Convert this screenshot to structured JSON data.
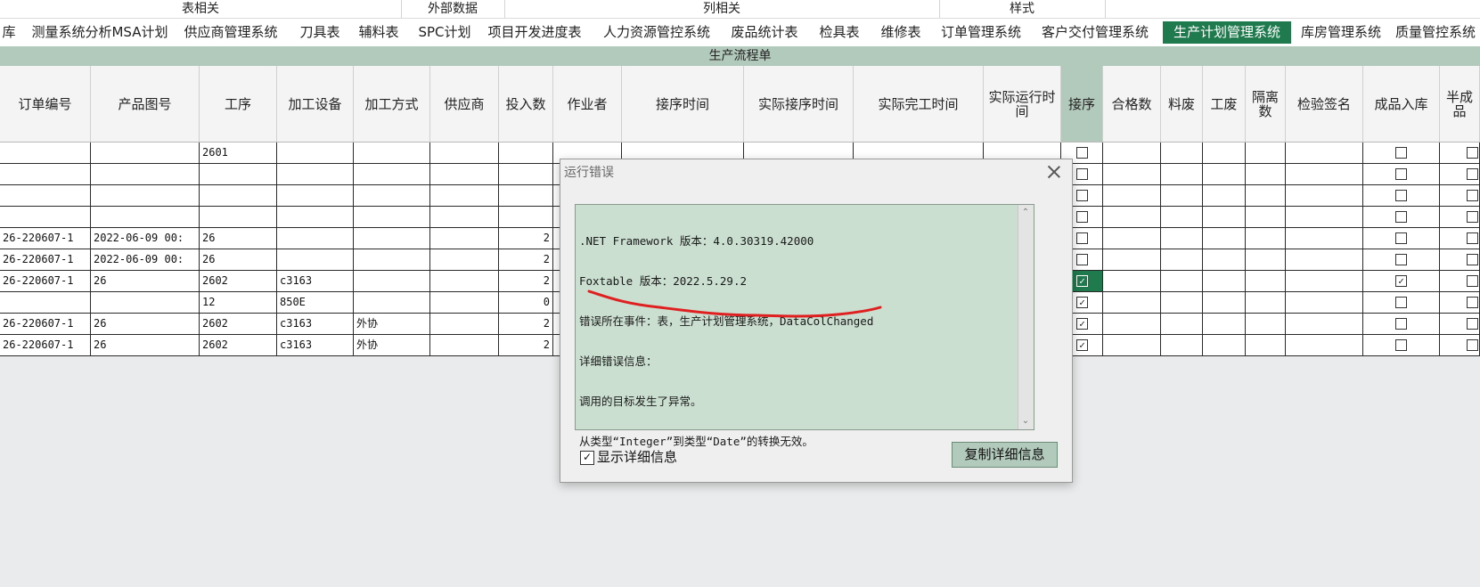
{
  "ribbon_groups": [
    "表相关",
    "外部数据",
    "列相关",
    "样式"
  ],
  "tabs": [
    {
      "label": "库",
      "active": false
    },
    {
      "label": "测量系统分析MSA计划",
      "active": false
    },
    {
      "label": "供应商管理系统",
      "active": false
    },
    {
      "label": "刀具表",
      "active": false
    },
    {
      "label": "辅料表",
      "active": false
    },
    {
      "label": "SPC计划",
      "active": false
    },
    {
      "label": "项目开发进度表",
      "active": false
    },
    {
      "label": "人力资源管控系统",
      "active": false
    },
    {
      "label": "废品统计表",
      "active": false
    },
    {
      "label": "检具表",
      "active": false
    },
    {
      "label": "维修表",
      "active": false
    },
    {
      "label": "订单管理系统",
      "active": false
    },
    {
      "label": "客户交付管理系统",
      "active": false
    },
    {
      "label": "生产计划管理系统",
      "active": true
    },
    {
      "label": "库房管理系统",
      "active": false
    },
    {
      "label": "质量管控系统",
      "active": false
    }
  ],
  "sheet_title": "生产流程单",
  "columns": [
    "订单编号",
    "产品图号",
    "工序",
    "加工设备",
    "加工方式",
    "供应商",
    "投入数",
    "作业者",
    "接序时间",
    "实际接序时间",
    "实际完工时间",
    "实际运行时间",
    "接序",
    "合格数",
    "料废",
    "工废",
    "隔离数",
    "检验签名",
    "成品入库",
    "半成品"
  ],
  "rows": [
    {
      "order": "",
      "drawing": "",
      "process": "2601",
      "equipment": "",
      "method": "",
      "supplier": "",
      "qty": "",
      "receive": false,
      "finished": false
    },
    {
      "order": "",
      "drawing": "",
      "process": "",
      "equipment": "",
      "method": "",
      "supplier": "",
      "qty": "",
      "receive": false,
      "finished": false
    },
    {
      "order": "",
      "drawing": "",
      "process": "",
      "equipment": "",
      "method": "",
      "supplier": "",
      "qty": "",
      "receive": false,
      "finished": false
    },
    {
      "order": "",
      "drawing": "",
      "process": "",
      "equipment": "",
      "method": "",
      "supplier": "",
      "qty": "",
      "receive": false,
      "finished": false
    },
    {
      "order": "26-220607-1",
      "drawing": "2022-06-09 00:",
      "process": "26",
      "equipment": "",
      "method": "",
      "supplier": "",
      "qty": "2",
      "receive": false,
      "finished": false
    },
    {
      "order": "26-220607-1",
      "drawing": "2022-06-09 00:",
      "process": "26",
      "equipment": "",
      "method": "",
      "supplier": "",
      "qty": "2",
      "receive": false,
      "finished": false
    },
    {
      "order": "26-220607-1",
      "drawing": "26",
      "process": "2602",
      "equipment": "c3163",
      "method": "",
      "supplier": "",
      "qty": "2",
      "receive": true,
      "finished": true
    },
    {
      "order": "",
      "drawing": "",
      "process": "12",
      "equipment": "850E",
      "method": "",
      "supplier": "",
      "qty": "0",
      "receive": true,
      "finished": false
    },
    {
      "order": "26-220607-1",
      "drawing": "26",
      "process": "2602",
      "equipment": "c3163",
      "method": "外协",
      "supplier": "",
      "qty": "2",
      "receive": true,
      "finished": false
    },
    {
      "order": "26-220607-1",
      "drawing": "26",
      "process": "2602",
      "equipment": "c3163",
      "method": "外协",
      "supplier": "",
      "qty": "2",
      "receive": true,
      "finished": false
    }
  ],
  "dialog": {
    "title": "运行错误",
    "lines": [
      ".NET Framework 版本：4.0.30319.42000",
      "Foxtable 版本：2022.5.29.2",
      "错误所在事件：表，生产计划管理系统，DataColChanged",
      "详细错误信息：",
      "调用的目标发生了异常。",
      "从类型“Integer”到类型“Date”的转换无效。"
    ],
    "show_details_label": "显示详细信息",
    "show_details_checked": true,
    "copy_button_label": "复制详细信息"
  },
  "colors": {
    "accent": "#1f7a4d",
    "header_green": "#b2cabb",
    "error_text_bg": "#cadfcf",
    "annotation": "#e02020"
  }
}
